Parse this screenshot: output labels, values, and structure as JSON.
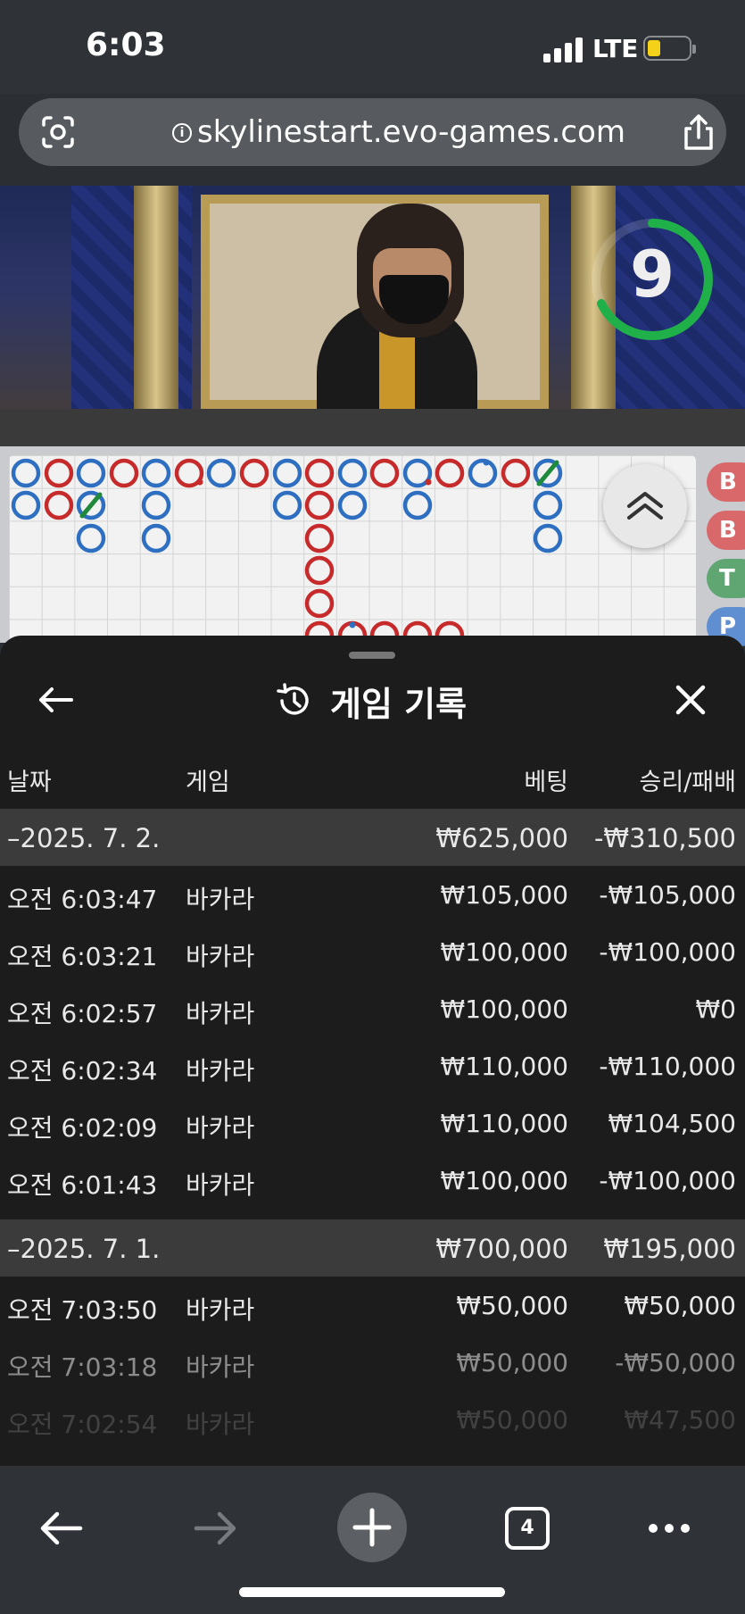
{
  "status_bar": {
    "time": "6:03",
    "network": "LTE"
  },
  "browser": {
    "url": "skylinestart.evo-games.com",
    "tab_count": "4"
  },
  "video": {
    "countdown": "9"
  },
  "bead_road": {
    "side_labels": [
      "B",
      "B",
      "T",
      "P"
    ],
    "colors": {
      "player": "#2f6fc2",
      "banker": "#c62a2a",
      "tie": "#1f8a3a"
    }
  },
  "history": {
    "title": "게임 기록",
    "columns": {
      "date": "날짜",
      "game": "게임",
      "bet": "베팅",
      "win_loss": "승리/패배"
    },
    "days": [
      {
        "date": "–2025. 7. 2.",
        "bet_total": "₩625,000",
        "win_total": "-₩310,500",
        "rows": [
          {
            "time": "오전 6:03:47",
            "game": "바카라",
            "bet": "₩105,000",
            "win": "-₩105,000"
          },
          {
            "time": "오전 6:03:21",
            "game": "바카라",
            "bet": "₩100,000",
            "win": "-₩100,000"
          },
          {
            "time": "오전 6:02:57",
            "game": "바카라",
            "bet": "₩100,000",
            "win": "₩0"
          },
          {
            "time": "오전 6:02:34",
            "game": "바카라",
            "bet": "₩110,000",
            "win": "-₩110,000"
          },
          {
            "time": "오전 6:02:09",
            "game": "바카라",
            "bet": "₩110,000",
            "win": "₩104,500"
          },
          {
            "time": "오전 6:01:43",
            "game": "바카라",
            "bet": "₩100,000",
            "win": "-₩100,000"
          }
        ]
      },
      {
        "date": "–2025. 7. 1.",
        "bet_total": "₩700,000",
        "win_total": "₩195,000",
        "rows": [
          {
            "time": "오전 7:03:50",
            "game": "바카라",
            "bet": "₩50,000",
            "win": "₩50,000"
          },
          {
            "time": "오전 7:03:18",
            "game": "바카라",
            "bet": "₩50,000",
            "win": "-₩50,000"
          },
          {
            "time": "오전 7:02:54",
            "game": "바카라",
            "bet": "₩50,000",
            "win": "₩47,500"
          }
        ]
      }
    ]
  }
}
